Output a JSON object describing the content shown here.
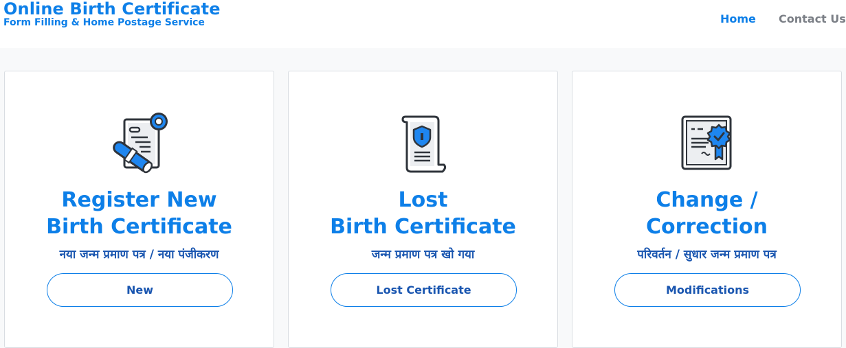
{
  "header": {
    "brand_title": "Online Birth Certificate",
    "brand_subtitle": "Form Filling & Home Postage Service",
    "nav": [
      {
        "label": "Home",
        "active": true
      },
      {
        "label": "Contact Us",
        "active": false
      }
    ]
  },
  "cards": [
    {
      "icon": "certificate-diploma-icon",
      "title_line1": "Register New",
      "title_line2": "Birth Certificate",
      "subtitle": "नया जन्म प्रमाण पत्र / नया पंजीकरण",
      "button": "New"
    },
    {
      "icon": "scroll-shield-icon",
      "title_line1": "Lost",
      "title_line2": "Birth Certificate",
      "subtitle": "जन्म प्रमाण पत्र खो गया",
      "button": "Lost Certificate"
    },
    {
      "icon": "certificate-badge-icon",
      "title_line1": "Change /",
      "title_line2": "Correction",
      "subtitle": "परिवर्तन / सुधार जन्म प्रमाण पत्र",
      "button": "Modifications"
    }
  ],
  "colors": {
    "accent": "#0d7fe8",
    "subtitle": "#1a56b0",
    "nav_inactive": "#7b7f86",
    "background": "#f8f9fa"
  }
}
